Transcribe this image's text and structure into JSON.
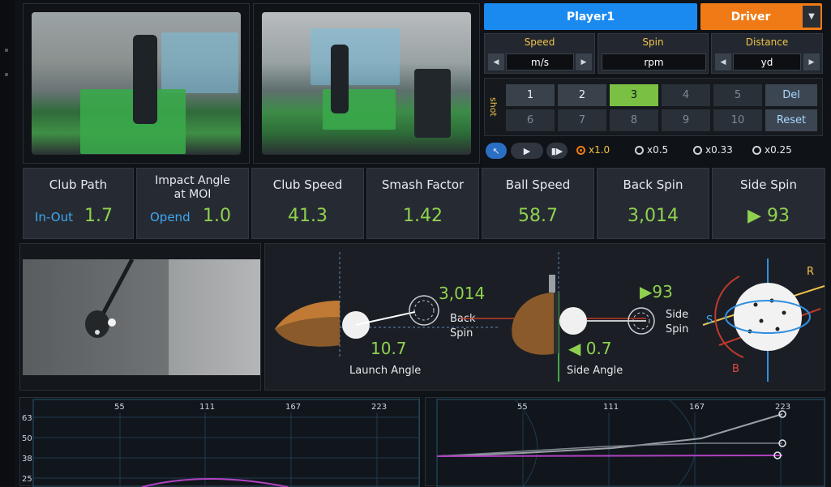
{
  "header": {
    "player": "Player1",
    "club": "Driver"
  },
  "units": {
    "speed": {
      "title": "Speed",
      "value": "m/s"
    },
    "spin": {
      "title": "Spin",
      "value": "rpm"
    },
    "distance": {
      "title": "Distance",
      "value": "yd"
    }
  },
  "shots": {
    "label": "shot",
    "items": [
      "1",
      "2",
      "3",
      "4",
      "5",
      "6",
      "7",
      "8",
      "9",
      "10"
    ],
    "active": "3",
    "del": "Del",
    "reset": "Reset"
  },
  "playback": {
    "speeds": [
      "x1.0",
      "x0.5",
      "x0.33",
      "x0.25"
    ],
    "selected": "x1.0"
  },
  "metrics": [
    {
      "label": "Club Path",
      "sub": "In-Out",
      "value": "1.7"
    },
    {
      "label": "Impact Angle\nat MOI",
      "sub": "Opend",
      "value": "1.0"
    },
    {
      "label": "Club Speed",
      "value": "41.3"
    },
    {
      "label": "Smash Factor",
      "value": "1.42"
    },
    {
      "label": "Ball Speed",
      "value": "58.7"
    },
    {
      "label": "Back Spin",
      "value": "3,014"
    },
    {
      "label": "Side Spin",
      "value": "▶ 93"
    }
  ],
  "visual": {
    "back_spin_value": "3,014",
    "back_spin_label_1": "Back",
    "back_spin_label_2": "Spin",
    "launch_angle_value": "10.7",
    "launch_angle_label": "Launch Angle",
    "side_spin_value": "▶93",
    "side_spin_label_1": "Side",
    "side_spin_label_2": "Spin",
    "side_angle_value": "◀ 0.7",
    "side_angle_label": "Side Angle",
    "axis_r": "R",
    "axis_s": "S",
    "axis_b": "B"
  },
  "charts": {
    "left": {
      "x_ticks": [
        "55",
        "111",
        "167",
        "223"
      ],
      "y_ticks": [
        "63",
        "50",
        "38",
        "25"
      ]
    },
    "right": {
      "x_ticks": [
        "55",
        "111",
        "167",
        "223"
      ]
    }
  },
  "colors": {
    "accent_blue": "#1a8af0",
    "accent_orange": "#f07a16",
    "value_green": "#8fd14f",
    "label_yellow": "#f0c24a",
    "sub_blue": "#3ea7f0"
  }
}
